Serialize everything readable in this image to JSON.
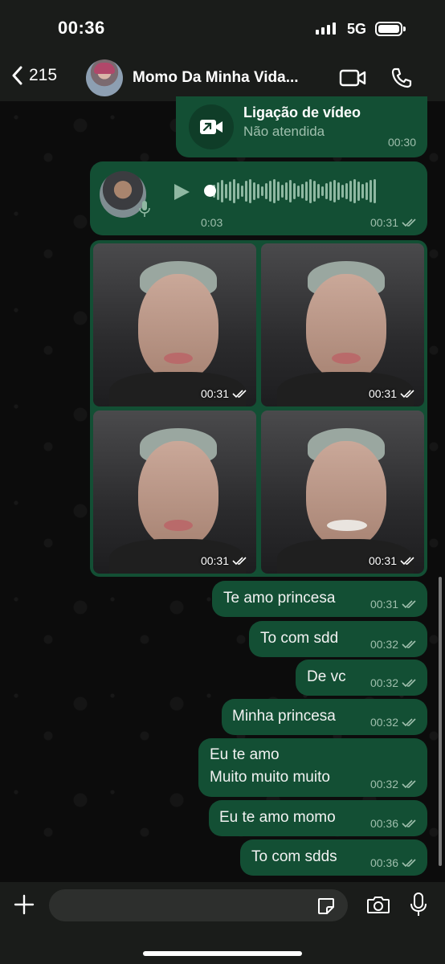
{
  "status_bar": {
    "time": "00:36",
    "network": "5G"
  },
  "header": {
    "back_count": "215",
    "contact_name": "Momo Da Minha Vida..."
  },
  "call": {
    "title": "Ligação de vídeo",
    "subtitle": "Não atendida",
    "time": "00:30"
  },
  "voice": {
    "duration": "0:03",
    "time": "00:31"
  },
  "photos": [
    {
      "time": "00:31"
    },
    {
      "time": "00:31"
    },
    {
      "time": "00:31"
    },
    {
      "time": "00:31"
    }
  ],
  "messages": [
    {
      "lines": [
        "Te amo princesa"
      ],
      "time": "00:31"
    },
    {
      "lines": [
        "To com sdd"
      ],
      "time": "00:32"
    },
    {
      "lines": [
        "De vc"
      ],
      "time": "00:32"
    },
    {
      "lines": [
        "Minha princesa"
      ],
      "time": "00:32"
    },
    {
      "lines": [
        "Eu te amo",
        "Muito muito muito"
      ],
      "time": "00:32"
    },
    {
      "lines": [
        "Eu te amo momo"
      ],
      "time": "00:36"
    },
    {
      "lines": [
        "To com sdds"
      ],
      "time": "00:36"
    }
  ],
  "composer": {
    "placeholder": ""
  },
  "colors": {
    "bubble": "#134f34",
    "meta": "#9fbfad",
    "bar": "#1a1c1a"
  }
}
